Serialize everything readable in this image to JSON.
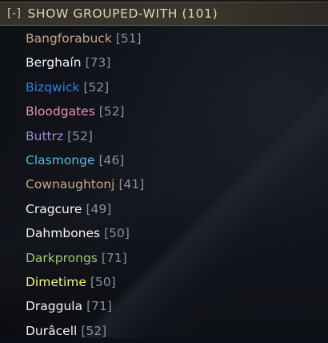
{
  "header": {
    "toggle_label": "[-]",
    "title": "SHOW GROUPED-WITH (101)"
  },
  "players": [
    {
      "name": "Bangforabuck",
      "level": "[51]",
      "color": "#c8a883"
    },
    {
      "name": "Berghaín",
      "level": "[73]",
      "color": "#f3f3f3"
    },
    {
      "name": "Bizqwick",
      "level": "[52]",
      "color": "#2a82e8"
    },
    {
      "name": "Bloodgates",
      "level": "[52]",
      "color": "#f28db2"
    },
    {
      "name": "Buttrz",
      "level": "[52]",
      "color": "#9d8ae0"
    },
    {
      "name": "Clasmonge",
      "level": "[46]",
      "color": "#50bce8"
    },
    {
      "name": "Cownaughtonj",
      "level": "[41]",
      "color": "#c8a883"
    },
    {
      "name": "Cragcure",
      "level": "[49]",
      "color": "#f3f3f3"
    },
    {
      "name": "Dahmbones",
      "level": "[50]",
      "color": "#f3f3f3"
    },
    {
      "name": "Darkprongs",
      "level": "[71]",
      "color": "#9ccc6a"
    },
    {
      "name": "Dimetime",
      "level": "[50]",
      "color": "#f7ef79"
    },
    {
      "name": "Draggula",
      "level": "[71]",
      "color": "#f3f3f3"
    },
    {
      "name": "Durâcell",
      "level": "[52]",
      "color": "#f3f3f3"
    }
  ]
}
